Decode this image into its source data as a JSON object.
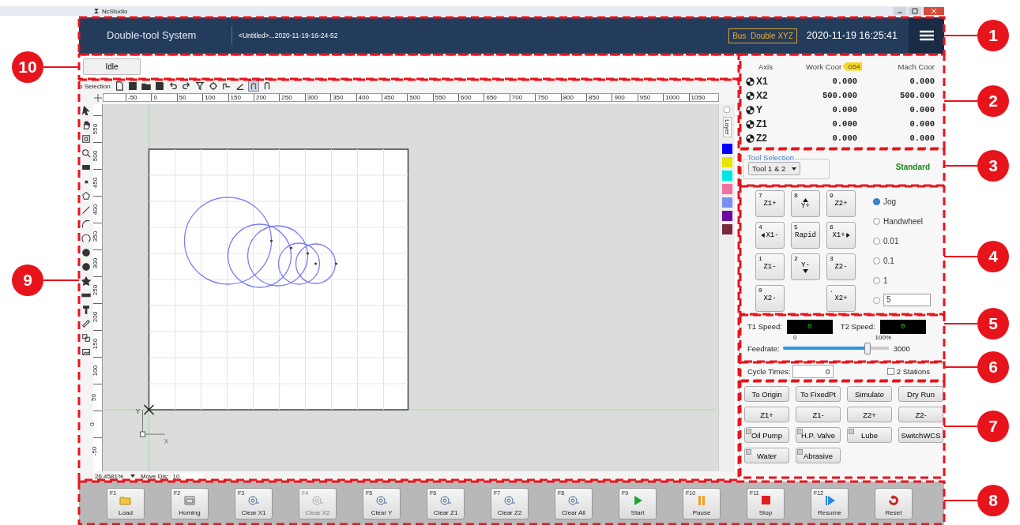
{
  "window": {
    "title": "NcStudio"
  },
  "header": {
    "system_name": "Double-tool System",
    "file_name": "<Untitled>...2020-11-19-16-24-52",
    "bus_badge": "Bus  Double XYZ",
    "datetime": "2020-11-19 16:25:41"
  },
  "status": {
    "state": "Idle"
  },
  "toolbar": {
    "selection": "o Selection"
  },
  "ruler": {
    "x_labels": [
      "-50",
      "0",
      "50",
      "100",
      "150",
      "200",
      "250",
      "300",
      "350",
      "400",
      "450",
      "500",
      "550",
      "600",
      "650",
      "700",
      "750",
      "800",
      "850",
      "900",
      "950",
      "1000",
      "1050"
    ],
    "y_labels": [
      "550",
      "500",
      "450",
      "400",
      "350",
      "300",
      "250",
      "200",
      "150",
      "100",
      "50",
      "0",
      "-50"
    ]
  },
  "canvas": {
    "axis_y": "Y",
    "axis_x": "X"
  },
  "layers": {
    "title": "Layer",
    "swatches": [
      {
        "color": "#0000ff"
      },
      {
        "color": "#e6e600"
      },
      {
        "color": "#00e6e6"
      },
      {
        "color": "#f070a0"
      },
      {
        "color": "#7890f0"
      },
      {
        "color": "#6a0aa0"
      },
      {
        "color": "#7a2a3a"
      }
    ]
  },
  "footer": {
    "zoom": "26.4581%",
    "move_dis_label": "Move Dis:",
    "move_dis": "10"
  },
  "axes": {
    "columns": [
      "Axis",
      "Work Coor",
      "Mach Coor"
    ],
    "wcs": "G54",
    "rows": [
      {
        "name": "X1",
        "work": "0.000",
        "mach": "0.000"
      },
      {
        "name": "X2",
        "work": "500.000",
        "mach": "500.000"
      },
      {
        "name": "Y",
        "work": "0.000",
        "mach": "0.000"
      },
      {
        "name": "Z1",
        "work": "0.000",
        "mach": "0.000"
      },
      {
        "name": "Z2",
        "work": "0.000",
        "mach": "0.000"
      }
    ]
  },
  "tool_selection": {
    "title": "Tool Selection",
    "value": "Tool 1 & 2",
    "mode": "Standard"
  },
  "keypad": [
    {
      "kind": "key",
      "key": "7",
      "label": "Z1+"
    },
    {
      "kind": "key_up",
      "key": "8",
      "label": "Y+"
    },
    {
      "kind": "key",
      "key": "9",
      "label": "Z2+"
    },
    {
      "kind": "key_left",
      "key": "4",
      "label": "X1-"
    },
    {
      "kind": "key",
      "key": "5",
      "label": "Rapid"
    },
    {
      "kind": "key_right",
      "key": "6",
      "label": "X1+"
    },
    {
      "kind": "key",
      "key": "1",
      "label": "Z1-"
    },
    {
      "kind": "key_down",
      "key": "2",
      "label": "Y-"
    },
    {
      "kind": "key",
      "key": "3",
      "label": "Z2-"
    },
    {
      "kind": "key",
      "key": "0",
      "label": "X2-"
    },
    {
      "kind": "blank"
    },
    {
      "kind": "key",
      "key": ".",
      "label": "X2+"
    }
  ],
  "jog_modes": [
    {
      "kind": "option",
      "label": "Jog",
      "selected": true
    },
    {
      "kind": "option",
      "label": "Handwheel",
      "selected": false
    },
    {
      "kind": "option",
      "label": "0.01",
      "selected": false
    },
    {
      "kind": "option",
      "label": "0.1",
      "selected": false
    },
    {
      "kind": "option",
      "label": "1",
      "selected": false
    },
    {
      "kind": "custom",
      "value": "5",
      "selected": false
    }
  ],
  "speed": {
    "t1_label": "T1 Speed:",
    "t1_value": "0",
    "t2_label": "T2 Speed:",
    "t2_value": "0",
    "scale_min": "0",
    "scale_max": "100%"
  },
  "feedrate": {
    "label": "Feedrate:",
    "level": 0.8,
    "value": "3000"
  },
  "cycle": {
    "label": "Cycle Times:",
    "value": "0"
  },
  "stations": {
    "label": "2 Stations",
    "checked": false
  },
  "actions": [
    {
      "kind": "action",
      "label": "To Origin"
    },
    {
      "kind": "action",
      "label": "To FixedPt"
    },
    {
      "kind": "action",
      "label": "Simulate"
    },
    {
      "kind": "action",
      "label": "Dry Run"
    },
    {
      "kind": "action",
      "label": "Z1+"
    },
    {
      "kind": "action",
      "label": "Z1-"
    },
    {
      "kind": "action",
      "label": "Z2+"
    },
    {
      "kind": "action",
      "label": "Z2-"
    },
    {
      "kind": "toggle",
      "label": "Oil Pump",
      "on": false
    },
    {
      "kind": "toggle",
      "label": "H.P. Valve",
      "on": false
    },
    {
      "kind": "toggle",
      "label": "Lube",
      "on": false
    },
    {
      "kind": "action",
      "label": "SwitchWCS"
    },
    {
      "kind": "toggle",
      "label": "Water",
      "on": false
    },
    {
      "kind": "toggle",
      "label": "Abrasive",
      "on": false
    }
  ],
  "function_keys": [
    {
      "kind": "folder",
      "key": "F1",
      "label": "Load",
      "disabled": false
    },
    {
      "kind": "home",
      "key": "F2",
      "label": "Homing",
      "disabled": false
    },
    {
      "kind": "clear",
      "key": "F3",
      "label": "Clear X1",
      "disabled": false
    },
    {
      "kind": "clear",
      "key": "F4",
      "label": "Clear X2",
      "disabled": true
    },
    {
      "kind": "clear",
      "key": "F5",
      "label": "Clear Y",
      "disabled": false
    },
    {
      "kind": "clear",
      "key": "F6",
      "label": "Clear Z1",
      "disabled": false
    },
    {
      "kind": "clear",
      "key": "F7",
      "label": "Clear Z2",
      "disabled": false
    },
    {
      "kind": "clear",
      "key": "F8",
      "label": "Clear All",
      "disabled": false
    },
    {
      "kind": "start",
      "key": "F9",
      "label": "Start",
      "disabled": false
    },
    {
      "kind": "pause",
      "key": "F10",
      "label": "Pause",
      "disabled": false
    },
    {
      "kind": "stop",
      "key": "F11",
      "label": "Stop",
      "disabled": false
    },
    {
      "kind": "resume",
      "key": "F12",
      "label": "Resume",
      "disabled": false
    },
    {
      "kind": "reset",
      "label": "Reset",
      "disabled": false
    }
  ],
  "callouts": [
    {
      "number": "1"
    },
    {
      "number": "2"
    },
    {
      "number": "3"
    },
    {
      "number": "4"
    },
    {
      "number": "5"
    },
    {
      "number": "6"
    },
    {
      "number": "7"
    },
    {
      "number": "8"
    },
    {
      "number": "9"
    },
    {
      "number": "10"
    }
  ]
}
